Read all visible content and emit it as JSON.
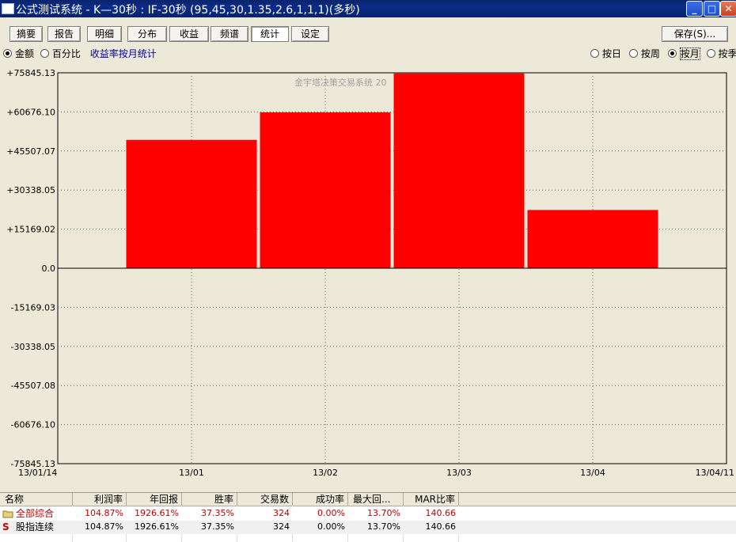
{
  "window": {
    "title": "公式测试系统 - K—30秒 : IF-30秒 (95,45,30,1.35,2.6,1,1,1)(多秒)"
  },
  "toolbar": {
    "buttons": [
      "摘要",
      "报告",
      "明细",
      "分布",
      "收益",
      "频谱",
      "统计",
      "设定"
    ],
    "active": "统计",
    "save_label": "保存(S)..."
  },
  "mode": {
    "amount_label": "金额",
    "percent_label": "百分比",
    "caption": "收益率按月统计",
    "day_label": "按日",
    "week_label": "按周",
    "month_label": "按月",
    "season_label": "按季"
  },
  "chart_data": {
    "type": "bar",
    "watermark": "金宇塔决策交易系统 20",
    "categories": [
      "13/01",
      "13/02",
      "13/03",
      "13/04"
    ],
    "values": [
      49800,
      60500,
      75600,
      22600
    ],
    "bar_color": "#FF0000",
    "ylim": [
      -75845.13,
      75845.13
    ],
    "y_ticks": [
      "+75845.13",
      "+60676.10",
      "+45507.07",
      "+30338.05",
      "+15169.02",
      "0.0",
      "-15169.03",
      "-30338.05",
      "-45507.08",
      "-60676.10",
      "-75845.13"
    ],
    "x_ticks": [
      "13/01/14",
      "13/01",
      "13/02",
      "13/03",
      "13/04",
      "13/04/11"
    ],
    "grid": true,
    "background": "#ECE9D8"
  },
  "table": {
    "headers": [
      "名称",
      "利润率",
      "年回报",
      "胜率",
      "交易数",
      "成功率",
      "最大回...",
      "MAR比率"
    ],
    "rows": [
      {
        "icon": "folder-icon",
        "name": "全部综合",
        "values": [
          "104.87%",
          "1926.61%",
          "37.35%",
          "324",
          "0.00%",
          "13.70%",
          "140.66"
        ],
        "color": "#C00000"
      },
      {
        "icon": "s-icon",
        "name": "股指连续",
        "values": [
          "104.87%",
          "1926.61%",
          "37.35%",
          "324",
          "0.00%",
          "13.70%",
          "140.66"
        ],
        "color": "#000000"
      }
    ]
  }
}
